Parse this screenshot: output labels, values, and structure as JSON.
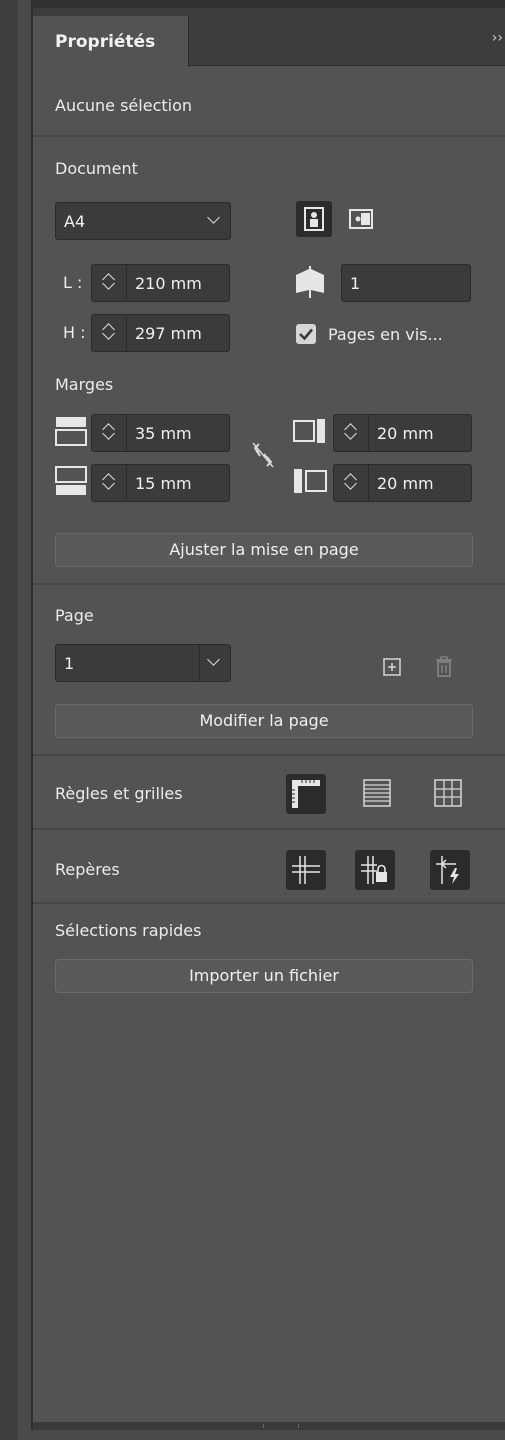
{
  "panel": {
    "tab_label": "Propriétés",
    "collapse_glyph": "››",
    "selection_label": "Aucune sélection"
  },
  "document": {
    "title": "Document",
    "page_size": "A4",
    "width_label": "L :",
    "width_value": "210 mm",
    "height_label": "H :",
    "height_value": "297 mm",
    "pages_value": "1",
    "facing_pages_label": "Pages en vis...",
    "facing_pages_checked": true,
    "orientation_selected": "portrait"
  },
  "margins": {
    "title": "Marges",
    "top": "35 mm",
    "bottom": "15 mm",
    "inside": "20 mm",
    "outside": "20 mm",
    "adjust_button": "Ajuster la mise en page"
  },
  "page": {
    "title": "Page",
    "current": "1",
    "edit_button": "Modifier la page"
  },
  "rulers": {
    "title": "Règles et grilles"
  },
  "guides": {
    "title": "Repères"
  },
  "quick_actions": {
    "title": "Sélections rapides",
    "import_button": "Importer un fichier"
  },
  "colors": {
    "panel_bg": "#535353",
    "field_bg": "#3b3b3b",
    "tab_bar": "#3d3d3d",
    "active_icon_bg": "#2b2b2b"
  }
}
